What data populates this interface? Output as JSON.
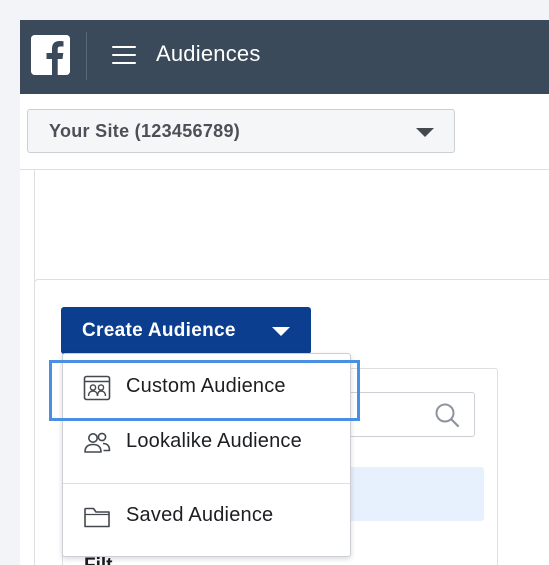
{
  "topbar": {
    "logo_icon": "facebook-logo-icon",
    "menu_icon": "hamburger-menu-icon",
    "title": "Audiences"
  },
  "account_select": {
    "value": "Your Site (123456789)",
    "icon": "caret-down-icon"
  },
  "create_button": {
    "label": "Create Audience",
    "icon": "caret-down-icon"
  },
  "dropdown": {
    "items": [
      {
        "label": "Custom Audience",
        "icon": "custom-audience-icon",
        "highlighted": true
      },
      {
        "label": "Lookalike Audience",
        "icon": "people-icon"
      },
      {
        "label": "Saved Audience",
        "icon": "folder-icon"
      }
    ]
  },
  "search": {
    "icon": "search-icon"
  },
  "filter_hint": "Filt",
  "colors": {
    "topbar_bg": "#3b4a5a",
    "button_bg": "#0b3e8f",
    "highlight_border": "#4a90e2",
    "info_band": "#e7f1fd"
  }
}
